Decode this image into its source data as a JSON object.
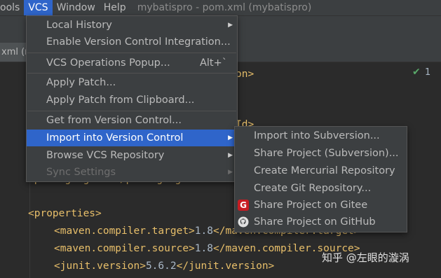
{
  "menubar": {
    "items": [
      "ools",
      "VCS",
      "Window",
      "Help"
    ],
    "title": "mybatispro - pom.xml (mybatispro)"
  },
  "tab": {
    "label": "xml (m"
  },
  "gutter": {
    "check_count": "1"
  },
  "code_lines": {
    "l1": "on>",
    "l2": "Id>",
    "packaging": "<packaging>war</packaging>",
    "properties": "<properties>",
    "target_open": "<maven.compiler.target>",
    "target_val": "1.8",
    "target_close": "</maven.compiler.target>",
    "source_open": "<maven.compiler.source>",
    "source_val": "1.8",
    "source_close": "</maven.compiler.source>",
    "junit_open": "<junit.version>",
    "junit_val": "5.6.2",
    "junit_close": "</junit.version>"
  },
  "vcs_menu": {
    "local_history": "Local History",
    "enable_vc": "Enable Version Control Integration...",
    "vcs_popup": "VCS Operations Popup...",
    "vcs_popup_shortcut": "Alt+`",
    "apply_patch": "Apply Patch...",
    "apply_patch_clip": "Apply Patch from Clipboard...",
    "get_from_vc": "Get from Version Control...",
    "import_vc": "Import into Version Control",
    "browse_vcs": "Browse VCS Repository",
    "sync_settings": "Sync Settings"
  },
  "import_submenu": {
    "import_svn": "Import into Subversion...",
    "share_svn": "Share Project (Subversion)...",
    "create_hg": "Create Mercurial Repository",
    "create_git": "Create Git Repository...",
    "share_gitee": "Share Project on Gitee",
    "share_github": "Share Project on GitHub"
  },
  "watermark": "知乎 @左眼的漩涡"
}
